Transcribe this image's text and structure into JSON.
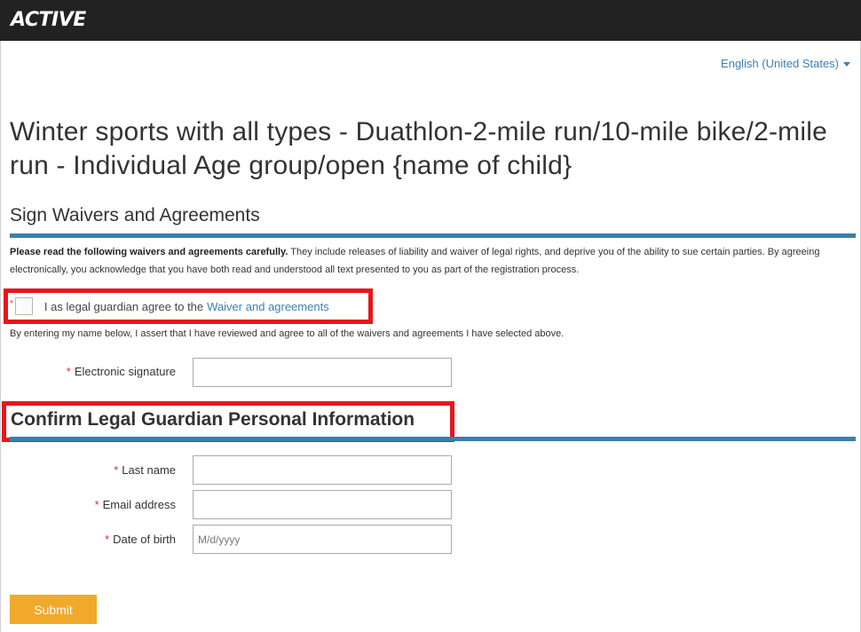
{
  "brand": {
    "logo_text": "ACTIVE"
  },
  "language": {
    "label": "English (United States)"
  },
  "page": {
    "title": "Winter sports with all types - Duathlon-2-mile run/10-mile bike/2-mile run - Individual Age group/open {name of child}"
  },
  "waivers": {
    "section_title": "Sign Waivers and Agreements",
    "intro_bold": "Please read the following waivers and agreements carefully.",
    "intro_rest": " They include releases of liability and waiver of legal rights, and deprive you of the ability to sue certain parties. By agreeing electronically, you acknowledge that you have both read and understood all text presented to you as part of the registration process.",
    "agree_label": "I as legal guardian agree to the",
    "agree_link": "Waiver and agreements",
    "assert_text": "By entering my name below, I assert that I have reviewed and agree to all of the waivers and agreements I have selected above.",
    "signature_label": "Electronic signature",
    "signature_value": ""
  },
  "guardian": {
    "section_title": "Confirm Legal Guardian Personal Information",
    "last_name_label": "Last name",
    "last_name_value": "",
    "email_label": "Email address",
    "email_value": "",
    "dob_label": "Date of birth",
    "dob_placeholder": "M/d/yyyy"
  },
  "required_marker": "*",
  "submit_label": "Submit",
  "colors": {
    "accent": "#3a80b4",
    "rule": "#3c7ea8",
    "submit": "#f0a92b",
    "required": "#d0342c",
    "highlight": "#e8151b"
  }
}
